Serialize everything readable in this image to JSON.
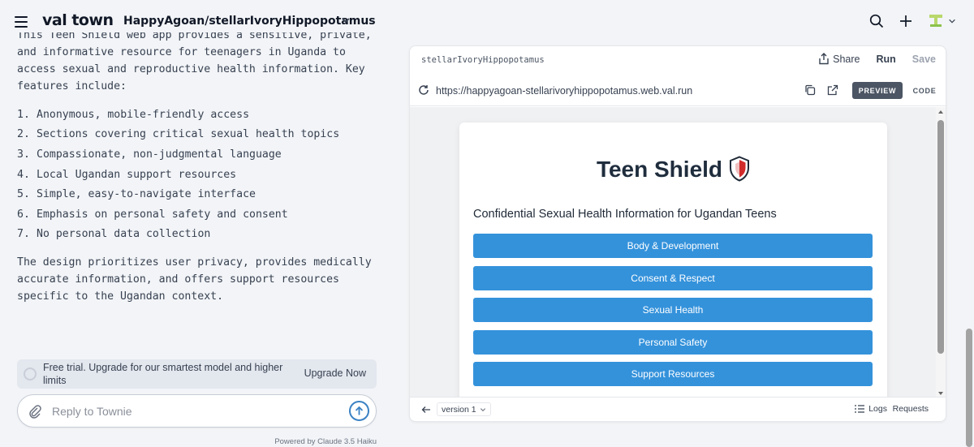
{
  "topbar": {
    "logo": "val town",
    "project": "HappyAgoan/stellarIvoryHippopotamus"
  },
  "chat": {
    "intro": "This Teen Shield web app provides a sensitive, private, and informative resource for teenagers in Uganda to access sexual and reproductive health information. Key features include:",
    "features": [
      {
        "num": "1.",
        "text": "Anonymous, mobile-friendly access"
      },
      {
        "num": "2.",
        "text": "Sections covering critical sexual health topics"
      },
      {
        "num": "3.",
        "text": "Compassionate, non-judgmental language"
      },
      {
        "num": "4.",
        "text": "Local Ugandan support resources"
      },
      {
        "num": "5.",
        "text": "Simple, easy-to-navigate interface"
      },
      {
        "num": "6.",
        "text": "Emphasis on personal safety and consent"
      },
      {
        "num": "7.",
        "text": "No personal data collection"
      }
    ],
    "closing": "The design prioritizes user privacy, provides medically accurate information, and offers support resources specific to the Ugandan context."
  },
  "trial": {
    "text": "Free trial. Upgrade for our smartest model and higher limits",
    "button": "Upgrade Now"
  },
  "reply": {
    "placeholder": "Reply to Townie"
  },
  "powered_by": "Powered by Claude 3.5 Haiku",
  "panel": {
    "name": "stellarIvoryHippopotamus",
    "share": "Share",
    "run": "Run",
    "save": "Save",
    "url": "https://happyagoan-stellarivoryhippopotamus.web.val.run",
    "preview": "PREVIEW",
    "code": "CODE",
    "version": "version 1",
    "logs": "Logs",
    "requests": "Requests"
  },
  "app": {
    "title": "Teen Shield",
    "subtitle": "Confidential Sexual Health Information for Ugandan Teens",
    "topics": [
      "Body & Development",
      "Consent & Respect",
      "Sexual Health",
      "Personal Safety",
      "Support Resources"
    ]
  },
  "colors": {
    "accent": "#3492db",
    "preview_bg": "#4b5563",
    "shield_red": "#d22b2b"
  }
}
